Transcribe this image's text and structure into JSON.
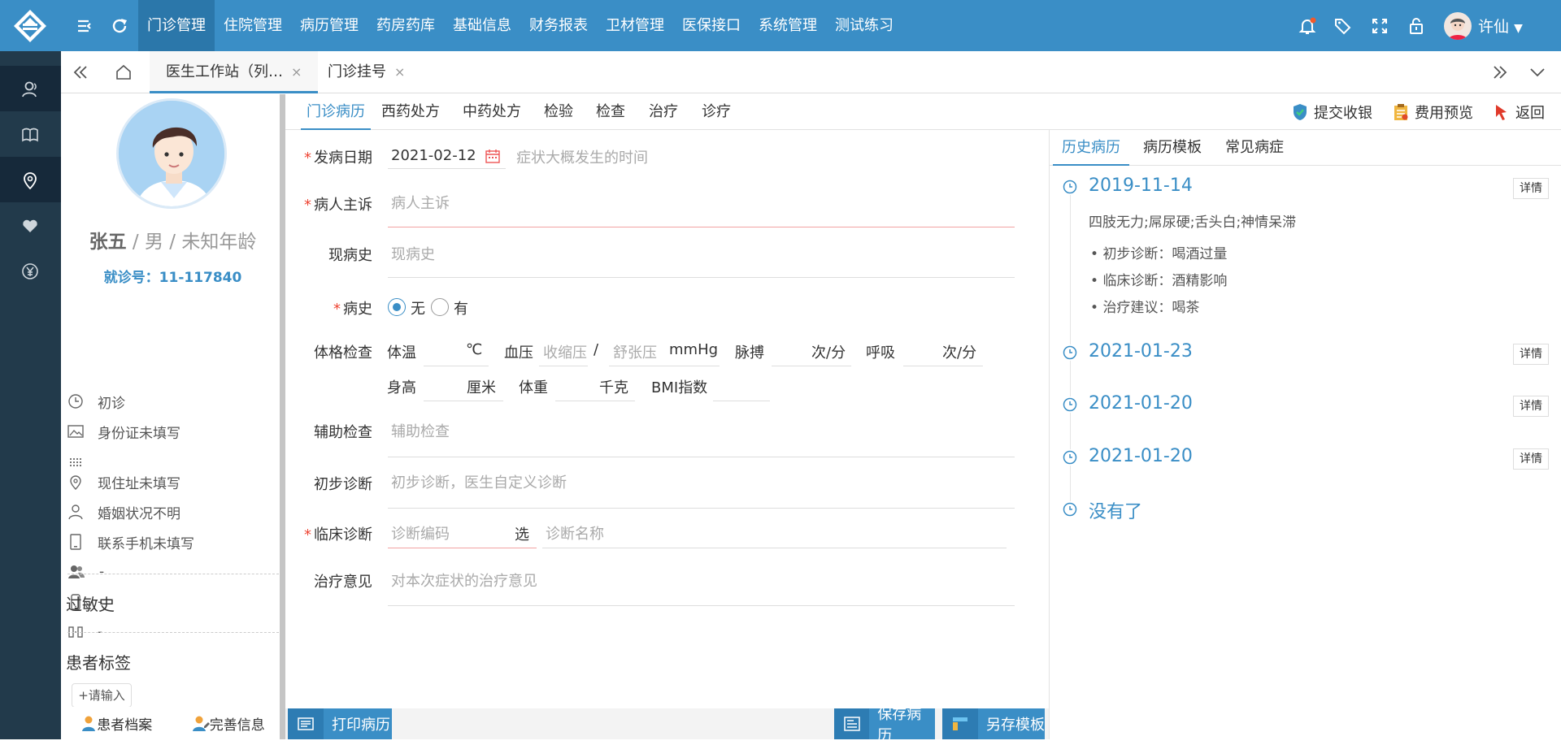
{
  "app": {
    "nav": [
      "门诊管理",
      "住院管理",
      "病历管理",
      "药房药库",
      "基础信息",
      "财务报表",
      "卫材管理",
      "医保接口",
      "系统管理",
      "测试练习"
    ],
    "user_name": "许仙"
  },
  "tabs": {
    "items": [
      {
        "label": "医生工作站（列…",
        "close": "×"
      },
      {
        "label": "门诊挂号",
        "close": "×"
      }
    ]
  },
  "patient": {
    "name": "张五",
    "sex_age": " / 男 / 未知年龄",
    "visit_no": "就诊号：11-117840",
    "visit_type": "初诊",
    "id_card": "身份证未填写",
    "address": "现住址未填写",
    "marriage": "婚姻状况不明",
    "phone": "联系手机未填写",
    "contact": "-",
    "mobile": "-",
    "other": "-",
    "allergy_title": "过敏史",
    "tags_title": "患者标签",
    "tag_input": "+请输入",
    "archive_btn": "患者档案",
    "complete_btn": "完善信息"
  },
  "subtabs": [
    "门诊病历",
    "西药处方",
    "中药处方",
    "检验",
    "检查",
    "治疗",
    "诊疗"
  ],
  "actions": {
    "submit": "提交收银",
    "preview": "费用预览",
    "back": "返回"
  },
  "form": {
    "onset_label": "发病日期",
    "onset_value": "2021-02-12",
    "onset_hint": "症状大概发生的时间",
    "complaint_label": "病人主诉",
    "complaint_ph": "病人主诉",
    "history_label": "现病史",
    "history_ph": "现病史",
    "past_label": "病史",
    "past_no": "无",
    "past_yes": "有",
    "exam_label": "体格检查",
    "temp_label": "体温",
    "temp_unit": "℃",
    "bp_label": "血压",
    "bp_sys_ph": "收缩压",
    "bp_sep": "/",
    "bp_dia_ph": "舒张压",
    "bp_unit": "mmHg",
    "pulse_label": "脉搏",
    "pulse_unit": "次/分",
    "resp_label": "呼吸",
    "resp_unit": "次/分",
    "height_label": "身高",
    "height_unit": "厘米",
    "weight_label": "体重",
    "weight_unit": "千克",
    "bmi_label": "BMI指数",
    "aux_label": "辅助检查",
    "aux_ph": "辅助检查",
    "prelim_label": "初步诊断",
    "prelim_ph": "初步诊断，医生自定义诊断",
    "clinical_label": "临床诊断",
    "clinical_code_ph": "诊断编码",
    "clinical_pick": "选",
    "clinical_name_ph": "诊断名称",
    "treat_label": "治疗意见",
    "treat_ph": "对本次症状的治疗意见",
    "print_btn": "打印病历",
    "save_btn": "保存病历",
    "save_tpl_btn": "另存模板"
  },
  "history": {
    "tabs": [
      "历史病历",
      "病历模板",
      "常见病症"
    ],
    "detail_label": "详情",
    "entries": [
      {
        "date": "2019-11-14",
        "symptom": "四肢无力;屌尿硬;舌头白;神情呆滞",
        "bullets": [
          "初步诊断：喝酒过量",
          "临床诊断：酒精影响",
          "治疗建议：喝茶"
        ]
      },
      {
        "date": "2021-01-23"
      },
      {
        "date": "2021-01-20"
      },
      {
        "date": "2021-01-20"
      }
    ],
    "end_label": "没有了"
  },
  "colors": {
    "primary": "#3a8ec6",
    "rail": "#223a4b",
    "required": "#e43"
  }
}
